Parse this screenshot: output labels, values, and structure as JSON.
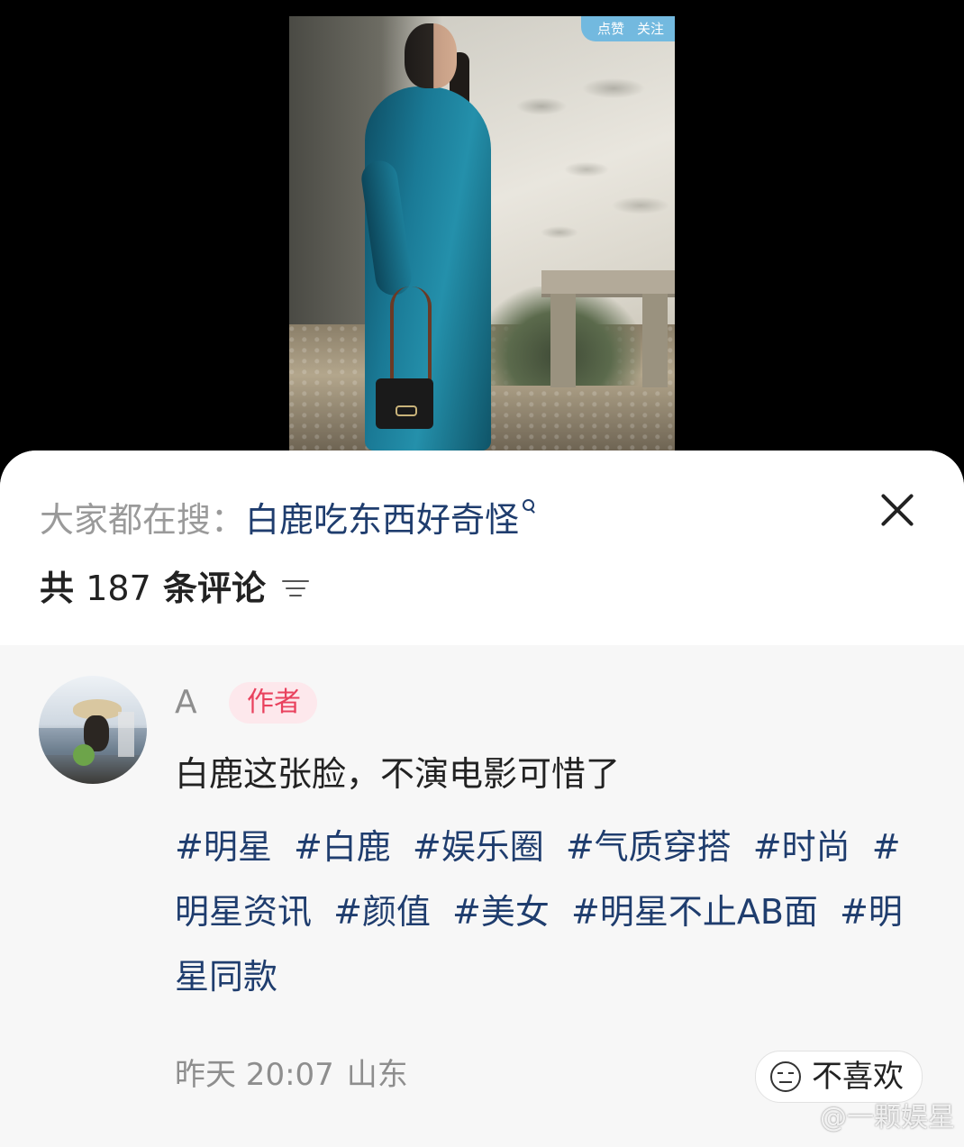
{
  "video": {
    "overlay_buttons": [
      "点赞",
      "关注"
    ]
  },
  "sheet": {
    "hot_search_prefix": "大家都在搜：",
    "hot_search_term": "白鹿吃东西好奇怪",
    "comment_count_prefix": "共 ",
    "comment_count_value": "187",
    "comment_count_suffix": " 条评论"
  },
  "comment": {
    "username": "A",
    "author_badge": "作者",
    "text": "白鹿这张脸，不演电影可惜了",
    "tags": [
      "#明星",
      "#白鹿",
      "#娱乐圈",
      "#气质穿搭",
      "#时尚",
      "#明星资讯",
      "#颜值",
      "#美女",
      "#明星不止AB面",
      "#明星同款"
    ],
    "time": "昨天 20:07",
    "location": "山东",
    "dislike_label": "不喜欢"
  },
  "watermark": "@一颗娱星",
  "colors": {
    "link": "#1f3d6e",
    "muted": "#8e8e8e",
    "author_badge_bg": "#fde8ec",
    "author_badge_text": "#e9425e",
    "comment_bg": "#f7f7f7"
  }
}
